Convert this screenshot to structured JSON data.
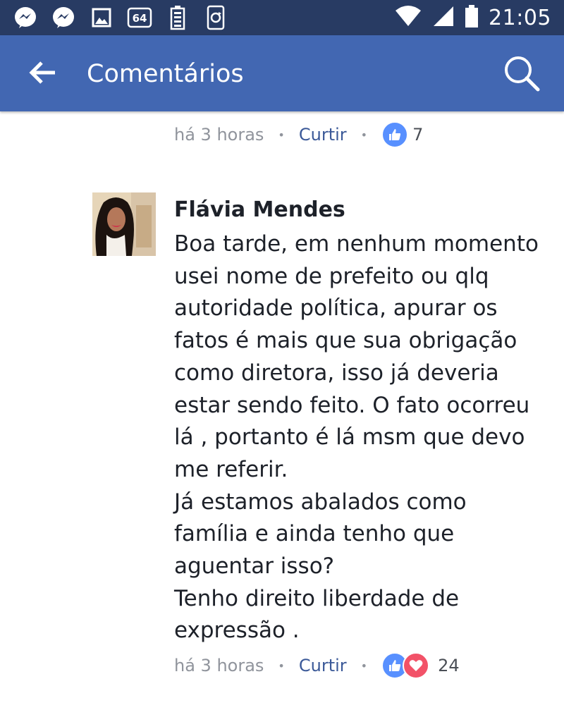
{
  "status_bar": {
    "time": "21:05",
    "badge": "64",
    "left_icons": [
      "messenger-icon",
      "messenger-icon",
      "gallery-icon",
      "badge-64-icon",
      "battery-saver-icon",
      "sync-icon"
    ],
    "right_icons": [
      "wifi-icon",
      "signal-icon",
      "battery-icon"
    ]
  },
  "appbar": {
    "title": "Comentários",
    "back_icon": "arrow-left-icon",
    "search_icon": "search-icon",
    "color": "#4267b2"
  },
  "previous_comment": {
    "time": "há 3 horas",
    "like_label": "Curtir",
    "reaction_count": "7",
    "reactions": [
      "like"
    ]
  },
  "comment": {
    "author": "Flávia Mendes",
    "lines": [
      "Boa tarde, em nenhum momento",
      "usei nome de prefeito ou qlq",
      "autoridade política,  apurar os",
      "fatos é mais que sua obrigação",
      "como diretora,  isso já deveria",
      "estar sendo feito.  O fato ocorreu",
      "lá , portanto é lá msm que devo",
      "me referir.",
      "Já estamos abalados como",
      "família e ainda tenho que",
      "aguentar isso?",
      "Tenho direito liberdade de",
      "expressão ."
    ],
    "time": "há 3 horas",
    "like_label": "Curtir",
    "reaction_count": "24",
    "reactions": [
      "like",
      "love"
    ]
  },
  "colors": {
    "status_bar": "#283b63",
    "like_blue": "#5890ff",
    "love_red": "#f25268",
    "link_blue": "#3b5998",
    "meta_gray": "#90949c"
  }
}
